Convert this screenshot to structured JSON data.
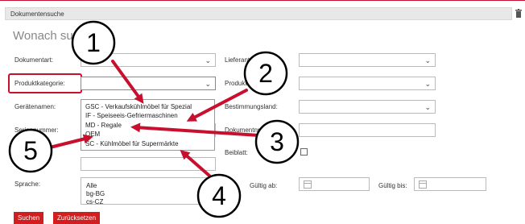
{
  "panel": {
    "title": "Dokumentensuche",
    "trash_icon": "trash-icon"
  },
  "heading": "Wonach suchen?",
  "form": {
    "dokumentart_label": "Dokumentart:",
    "produktkategorie_label": "Produktkategorie:",
    "geraetenamen_label": "Gerätenamen:",
    "seriennummer_label": "Seriennummer:",
    "sprache_label": "Sprache:",
    "lieferant_label": "Lieferant:",
    "produkt_label": "Produkt:",
    "bestimmungsland_label": "Bestimmungsland:",
    "dokument_label": "Dokumentnr.:",
    "beiblatt_label": "Beiblatt:",
    "gueltig_ab_label": "Gültig ab:",
    "gueltig_bis_label": "Gültig bis:"
  },
  "dropdown": {
    "items": [
      "GSC - Verkaufskühlmöbel für Spezial",
      "IF - Speiseeis-Gefriermaschinen",
      "MD - Regale",
      "OEM",
      "SC - Kühlmöbel für Supermärkte"
    ]
  },
  "sprache_options": [
    "Alle",
    "bg-BG",
    "cs-CZ"
  ],
  "buttons": {
    "search": "Suchen",
    "reset": "Zurücksetzen"
  },
  "callouts": [
    "1",
    "2",
    "3",
    "4",
    "5"
  ],
  "colors": {
    "accent": "#c8102e",
    "button": "#d21e1e"
  }
}
